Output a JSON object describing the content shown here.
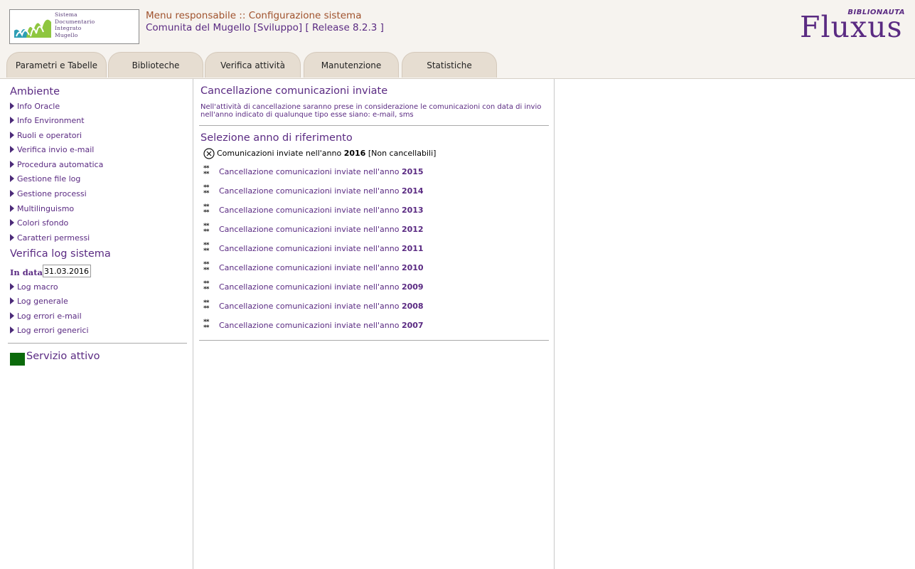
{
  "header": {
    "logo_lines": [
      "Sistema",
      "Documentario",
      "Integrato",
      "Mugello"
    ],
    "title": "Menu responsabile :: Configurazione sistema",
    "subtitle": "Comunita del Mugello [Sviluppo] [ Release 8.2.3 ]",
    "brand_name": "Fluxus",
    "brand_tag": "BIBLIONAUTA"
  },
  "tabs": [
    {
      "label": "Parametri e Tabelle"
    },
    {
      "label": "Biblioteche"
    },
    {
      "label": "Verifica attività"
    },
    {
      "label": "Manutenzione"
    },
    {
      "label": "Statistiche"
    }
  ],
  "sidebar": {
    "ambiente_title": "Ambiente",
    "ambiente_items": [
      {
        "label": "Info Oracle"
      },
      {
        "label": "Info Environment"
      },
      {
        "label": "Ruoli e operatori"
      },
      {
        "label": "Verifica invio e-mail"
      },
      {
        "label": "Procedura automatica"
      },
      {
        "label": "Gestione file log"
      },
      {
        "label": "Gestione processi"
      },
      {
        "label": "Multilinguismo"
      },
      {
        "label": "Colori sfondo"
      },
      {
        "label": "Caratteri permessi"
      }
    ],
    "log_title": "Verifica log sistema",
    "date_label": "In data",
    "date_value": "31.03.2016",
    "log_items": [
      {
        "label": "Log macro"
      },
      {
        "label": "Log generale"
      },
      {
        "label": "Log errori e-mail"
      },
      {
        "label": "Log errori generici"
      }
    ],
    "status_text": "Servizio attivo",
    "status_color": "#0b6a0b"
  },
  "main": {
    "title": "Cancellazione comunicazioni inviate",
    "description": "Nell'attività di cancellazione saranno prese in considerazione le comunicazioni con data di invio nell'anno indicato di qualunque tipo esse siano: e-mail, sms",
    "selection_title": "Selezione anno di riferimento",
    "current": {
      "prefix": "Comunicazioni inviate nell'anno",
      "year": "2016",
      "suffix": "[Non cancellabili]"
    },
    "year_prefix": "Cancellazione comunicazioni inviate nell'anno",
    "years": [
      "2015",
      "2014",
      "2013",
      "2012",
      "2011",
      "2010",
      "2009",
      "2008",
      "2007"
    ]
  },
  "colors": {
    "accent_purple": "#5a2a82",
    "header_title": "#a0522d",
    "tab_bg": "#e6ddd1"
  }
}
